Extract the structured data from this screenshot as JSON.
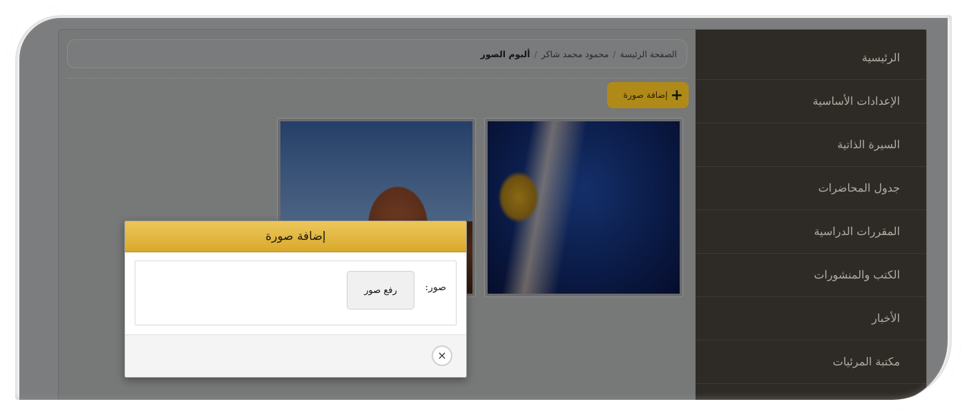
{
  "sidebar": {
    "items": [
      {
        "label": "الرئيسية"
      },
      {
        "label": "الإعدادات الأساسية"
      },
      {
        "label": "السيرة الذاتية"
      },
      {
        "label": "جدول المحاضرات"
      },
      {
        "label": "المقررات الدراسية"
      },
      {
        "label": "الكتب والمنشورات"
      },
      {
        "label": "الأخبار"
      },
      {
        "label": "مكتبة المرئيات"
      }
    ]
  },
  "breadcrumb": {
    "home": "الصفحة الرئيسة",
    "user": "محمود محمد شاكر",
    "current": "ألبوم الصور",
    "separator": "/"
  },
  "toolbar": {
    "add_photo_label": "إضافة صورة",
    "add_icon": "plus-icon"
  },
  "gallery": {
    "photos": [
      {
        "subject": "jellyfish"
      },
      {
        "subject": "desert"
      }
    ]
  },
  "modal": {
    "title": "إضافة صورة",
    "photos_label": "صور:",
    "upload_button": "رفع صور",
    "close_icon": "×"
  },
  "colors": {
    "accent": "#d9a92c",
    "sidebar_bg": "#2e2b26",
    "overlay": "#7c7d7e"
  }
}
